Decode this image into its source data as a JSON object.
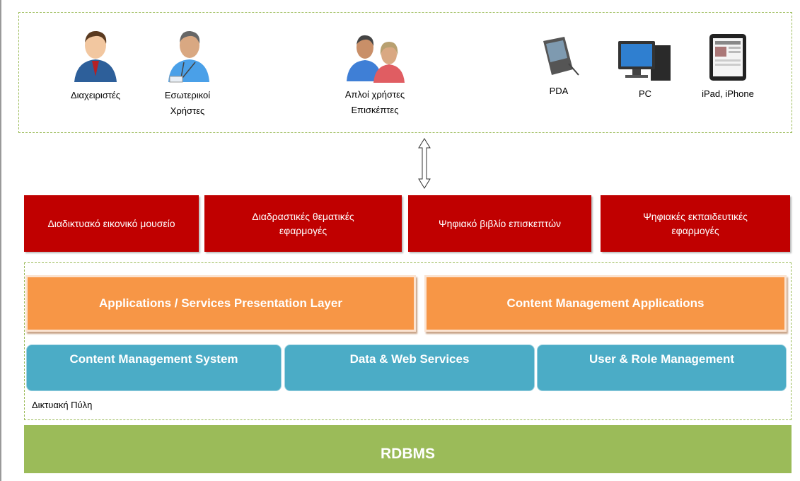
{
  "actors": [
    {
      "label": "Διαχειριστές",
      "icon": "admin-user-icon"
    },
    {
      "label": "Εσωτερικοί\nΧρήστες",
      "line1": "Εσωτερικοί",
      "line2": "Χρήστες",
      "icon": "internal-user-icon"
    },
    {
      "line1": "Απλοί χρήστες",
      "line2": "Επισκέπτες",
      "icon": "users-group-icon"
    }
  ],
  "devices": [
    {
      "label": "PDA",
      "icon": "pda-icon"
    },
    {
      "label": "PC",
      "icon": "pc-icon"
    },
    {
      "label": "iPad, iPhone",
      "icon": "ipad-icon"
    }
  ],
  "applications": [
    {
      "label": "Διαδικτυακό εικονικό μουσείο"
    },
    {
      "line1": "Διαδραστικές θεματικές",
      "line2": "εφαρμογές"
    },
    {
      "label": "Ψηφιακό βιβλίο επισκεπτών"
    },
    {
      "line1": "Ψηφιακές εκπαιδευτικές",
      "line2": "εφαρμογές"
    }
  ],
  "portal": {
    "label": "Δικτυακή Πύλη",
    "presentation": [
      "Applications / Services Presentation Layer",
      "Content Management Applications"
    ],
    "services": [
      "Content Management System",
      "Data & Web Services",
      "User & Role Management"
    ]
  },
  "database": {
    "label": "RDBMS"
  },
  "colors": {
    "red": "#c00000",
    "orange": "#f79646",
    "blue": "#4bacc6",
    "green": "#9bbb59"
  }
}
